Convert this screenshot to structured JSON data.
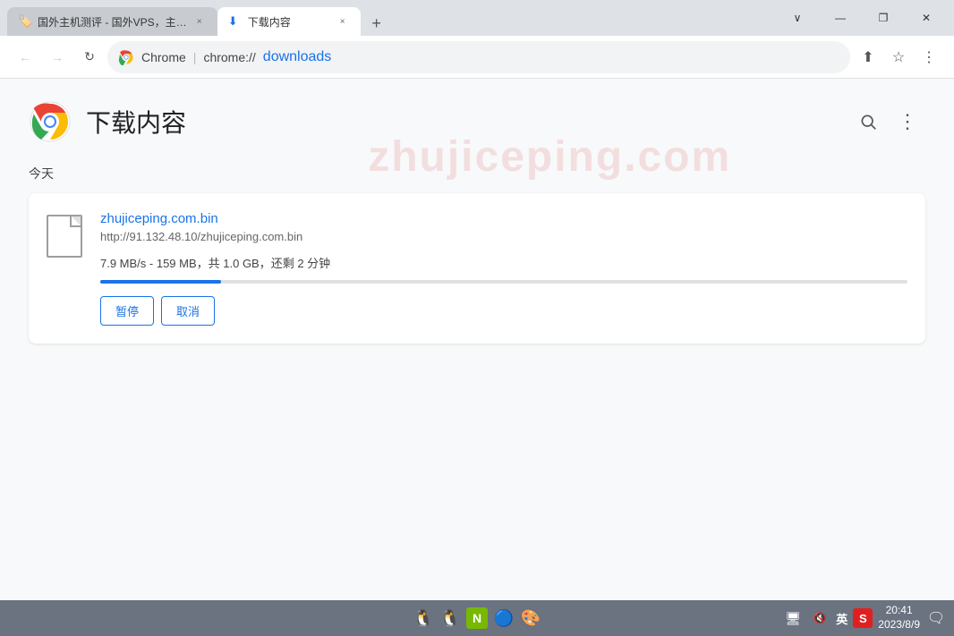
{
  "titlebar": {
    "tab1": {
      "title": "国外主机测评 - 国外VPS，主…",
      "close_label": "×"
    },
    "tab2": {
      "title": "下载内容",
      "close_label": "×"
    },
    "new_tab_label": "+",
    "window_controls": {
      "chevron_down": "∨",
      "minimize": "—",
      "restore": "❐",
      "close": "✕"
    }
  },
  "toolbar": {
    "back_label": "←",
    "forward_label": "→",
    "reload_label": "↻",
    "address": {
      "site_name": "Chrome",
      "separator": "|",
      "url_start": "chrome://",
      "url_highlight": "downloads"
    },
    "share_label": "⬆",
    "bookmark_label": "☆",
    "more_label": "⋮"
  },
  "page": {
    "title": "下载内容",
    "search_label": "🔍",
    "more_label": "⋮",
    "watermark": "zhujiceping.com",
    "section_today": "今天",
    "download": {
      "filename": "zhujiceping.com.bin",
      "url": "http://91.132.48.10/zhujiceping.com.bin",
      "status": "7.9 MB/s - 159 MB，共 1.0 GB，还剩 2 分钟",
      "progress_percent": 15,
      "pause_label": "暂停",
      "cancel_label": "取消"
    }
  },
  "taskbar": {
    "icons": [
      "🐧",
      "🐧",
      "🟢",
      "🔵",
      "🎨"
    ],
    "lang": "英",
    "sogou_label": "S",
    "time": "20:41",
    "date": "2023/8/9",
    "notify_label": "🗨"
  }
}
